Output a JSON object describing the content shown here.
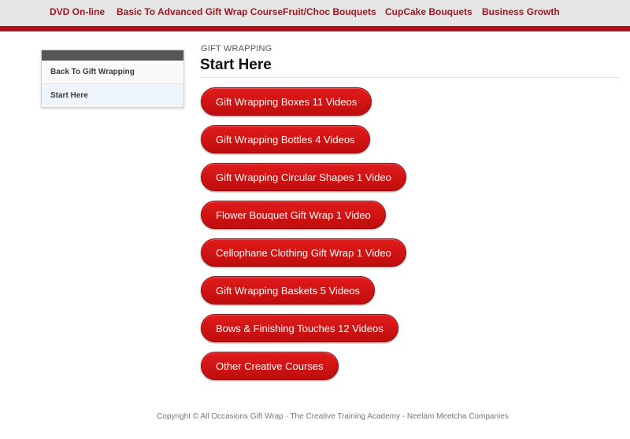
{
  "nav": {
    "items": [
      "DVD On-line",
      "Basic To Advanced Gift Wrap Course",
      "Fruit/Choc Bouquets",
      "CupCake Bouquets",
      "Business Growth"
    ]
  },
  "sidebar": {
    "items": [
      {
        "label": "Back To Gift Wrapping"
      },
      {
        "label": "Start Here"
      }
    ]
  },
  "main": {
    "kicker": "GIFT WRAPPING",
    "title": "Start Here",
    "buttons": [
      "Gift Wrapping Boxes 11 Videos",
      "Gift Wrapping Bottles 4 Videos",
      "Gift Wrapping Circular Shapes 1 Video",
      "Flower Bouquet Gift Wrap 1 Video",
      "Cellophane Clothing Gift Wrap 1 Video",
      "Gift Wrapping Baskets 5 Videos",
      "Bows & Finishing Touches 12 Videos",
      "Other Creative Courses"
    ]
  },
  "footer": {
    "copyright": "Copyright © All Occasions Gift Wrap - The Creative Training Academy - Neelam Meetcha Companies"
  },
  "colors": {
    "brand_red": "#b01218",
    "button_red": "#d31313",
    "nav_bg": "#e6e6e6"
  }
}
